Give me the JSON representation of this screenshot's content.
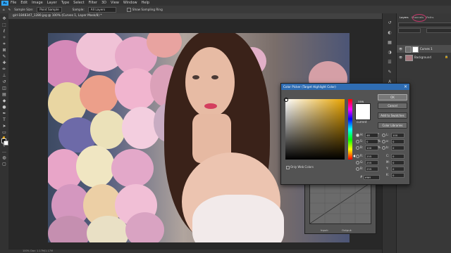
{
  "menu": {
    "logo": "Ps",
    "items": [
      "File",
      "Edit",
      "Image",
      "Layer",
      "Type",
      "Select",
      "Filter",
      "3D",
      "View",
      "Window",
      "Help"
    ]
  },
  "options": {
    "sample_size_label": "Sample Size:",
    "sample_size_value": "Point Sample",
    "sample_label": "Sample:",
    "sample_value": "All Layers",
    "show_ring": "Show Sampling Ring"
  },
  "document": {
    "tab_title": "girl-1848347_1280.jpg @ 100% (Curves 1, Layer Mask/8) *",
    "status": "100%   Doc: 1.17M/1.17M"
  },
  "panels": {
    "tabs": [
      "Layers",
      "Channels",
      "Paths"
    ],
    "layer1": "Curves 1",
    "layer2": "Background"
  },
  "color_picker": {
    "title": "Color Picker (Target Highlight Color)",
    "ok": "OK",
    "cancel": "Cancel",
    "add_swatches": "Add to Swatches",
    "libraries": "Color Libraries",
    "new_label": "new",
    "current_label": "current",
    "only_web": "Only Web Colors",
    "fields": {
      "H": "48",
      "S": "0",
      "B": "100",
      "R": "255",
      "G": "255",
      "B2": "255",
      "L": "100",
      "a": "0",
      "b": "0",
      "C": "0",
      "M": "0",
      "Y": "0",
      "K": "0",
      "hex": "ffffff"
    },
    "units": {
      "deg": "°",
      "pct": "%"
    }
  },
  "curves": {
    "input_label": "Input:",
    "output_label": "Output:"
  },
  "colors": {
    "accent": "#2f6db3",
    "ps_blue": "#31a8ff"
  }
}
